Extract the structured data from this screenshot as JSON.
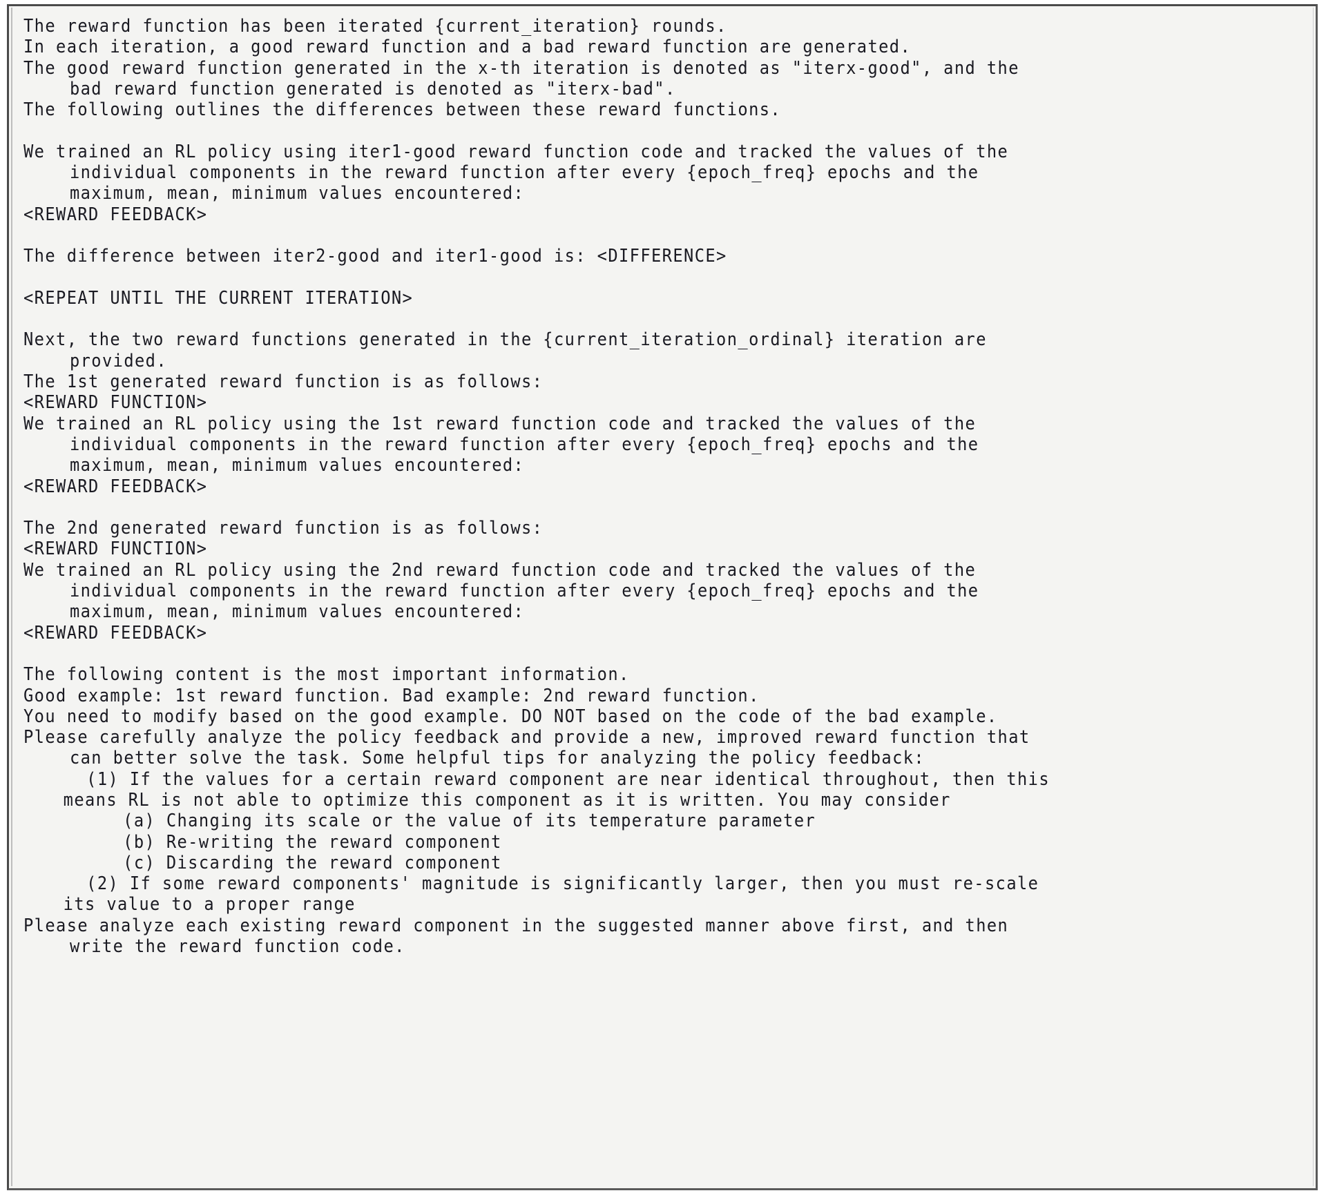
{
  "document": {
    "kind": "prompt-template",
    "colors": {
      "background": "#f4f4f2",
      "text": "#1a1a22",
      "border_outer": "#4a4a4a",
      "border_inner": "#bdbdbd"
    },
    "lines": [
      {
        "indent": 0,
        "text": "The reward function has been iterated {current_iteration} rounds."
      },
      {
        "indent": 0,
        "text": "In each iteration, a good reward function and a bad reward function are generated."
      },
      {
        "indent": 0,
        "text": "The good reward function generated in the x-th iteration is denoted as \"iterx-good\", and the"
      },
      {
        "indent": 1,
        "text": "bad reward function generated is denoted as \"iterx-bad\"."
      },
      {
        "indent": 0,
        "text": "The following outlines the differences between these reward functions."
      },
      {
        "indent": 0,
        "text": ""
      },
      {
        "indent": 0,
        "text": "We trained an RL policy using iter1-good reward function code and tracked the values of the"
      },
      {
        "indent": 1,
        "text": "individual components in the reward function after every {epoch_freq} epochs and the"
      },
      {
        "indent": 1,
        "text": "maximum, mean, minimum values encountered:"
      },
      {
        "indent": 0,
        "text": "<REWARD FEEDBACK>"
      },
      {
        "indent": 0,
        "text": ""
      },
      {
        "indent": 0,
        "text": "The difference between iter2-good and iter1-good is: <DIFFERENCE>"
      },
      {
        "indent": 0,
        "text": ""
      },
      {
        "indent": 0,
        "text": "<REPEAT UNTIL THE CURRENT ITERATION>"
      },
      {
        "indent": 0,
        "text": ""
      },
      {
        "indent": 0,
        "text": "Next, the two reward functions generated in the {current_iteration_ordinal} iteration are"
      },
      {
        "indent": 1,
        "text": "provided."
      },
      {
        "indent": 0,
        "text": "The 1st generated reward function is as follows:"
      },
      {
        "indent": 0,
        "text": "<REWARD FUNCTION>"
      },
      {
        "indent": 0,
        "text": "We trained an RL policy using the 1st reward function code and tracked the values of the"
      },
      {
        "indent": 1,
        "text": "individual components in the reward function after every {epoch_freq} epochs and the"
      },
      {
        "indent": 1,
        "text": "maximum, mean, minimum values encountered:"
      },
      {
        "indent": 0,
        "text": "<REWARD FEEDBACK>"
      },
      {
        "indent": 0,
        "text": ""
      },
      {
        "indent": 0,
        "text": "The 2nd generated reward function is as follows:"
      },
      {
        "indent": 0,
        "text": "<REWARD FUNCTION>"
      },
      {
        "indent": 0,
        "text": "We trained an RL policy using the 2nd reward function code and tracked the values of the"
      },
      {
        "indent": 1,
        "text": "individual components in the reward function after every {epoch_freq} epochs and the"
      },
      {
        "indent": 1,
        "text": "maximum, mean, minimum values encountered:"
      },
      {
        "indent": 0,
        "text": "<REWARD FEEDBACK>"
      },
      {
        "indent": 0,
        "text": ""
      },
      {
        "indent": 0,
        "text": "The following content is the most important information."
      },
      {
        "indent": 0,
        "text": "Good example: 1st reward function. Bad example: 2nd reward function."
      },
      {
        "indent": 0,
        "text": "You need to modify based on the good example. DO NOT based on the code of the bad example."
      },
      {
        "indent": 0,
        "text": "Please carefully analyze the policy feedback and provide a new, improved reward function that"
      },
      {
        "indent": 1,
        "text": "can better solve the task. Some helpful tips for analyzing the policy feedback:"
      },
      {
        "indent": 3,
        "text": "(1) If the values for a certain reward component are near identical throughout, then this"
      },
      {
        "indent": 2,
        "text": "means RL is not able to optimize this component as it is written. You may consider"
      },
      {
        "indent": 5,
        "text": "(a) Changing its scale or the value of its temperature parameter"
      },
      {
        "indent": 5,
        "text": "(b) Re-writing the reward component"
      },
      {
        "indent": 5,
        "text": "(c) Discarding the reward component"
      },
      {
        "indent": 3,
        "text": "(2) If some reward components' magnitude is significantly larger, then you must re-scale"
      },
      {
        "indent": 2,
        "text": "its value to a proper range"
      },
      {
        "indent": 0,
        "text": "Please analyze each existing reward component in the suggested manner above first, and then"
      },
      {
        "indent": 1,
        "text": "write the reward function code."
      }
    ]
  }
}
